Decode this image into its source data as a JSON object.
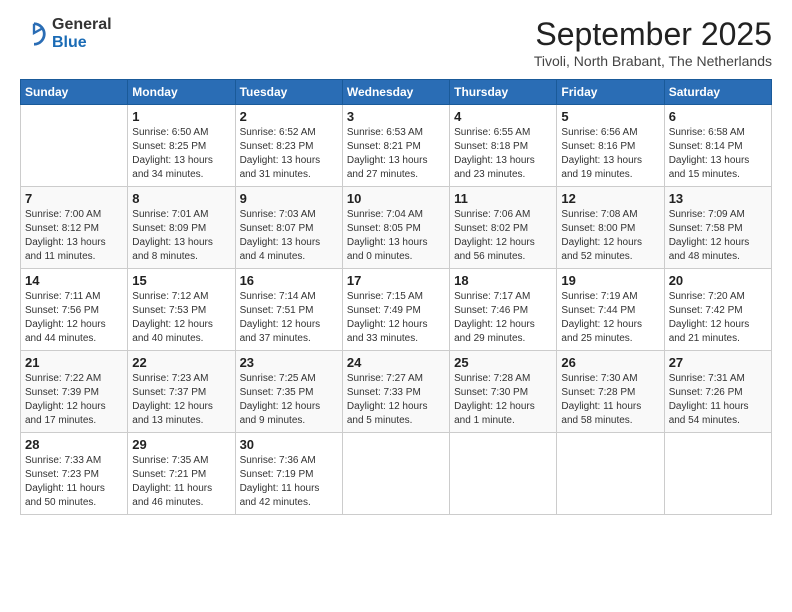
{
  "header": {
    "logo": {
      "general": "General",
      "blue": "Blue"
    },
    "month": "September 2025",
    "location": "Tivoli, North Brabant, The Netherlands"
  },
  "weekdays": [
    "Sunday",
    "Monday",
    "Tuesday",
    "Wednesday",
    "Thursday",
    "Friday",
    "Saturday"
  ],
  "weeks": [
    [
      {
        "day": "",
        "sunrise": "",
        "sunset": "",
        "daylight": ""
      },
      {
        "day": "1",
        "sunrise": "Sunrise: 6:50 AM",
        "sunset": "Sunset: 8:25 PM",
        "daylight": "Daylight: 13 hours and 34 minutes."
      },
      {
        "day": "2",
        "sunrise": "Sunrise: 6:52 AM",
        "sunset": "Sunset: 8:23 PM",
        "daylight": "Daylight: 13 hours and 31 minutes."
      },
      {
        "day": "3",
        "sunrise": "Sunrise: 6:53 AM",
        "sunset": "Sunset: 8:21 PM",
        "daylight": "Daylight: 13 hours and 27 minutes."
      },
      {
        "day": "4",
        "sunrise": "Sunrise: 6:55 AM",
        "sunset": "Sunset: 8:18 PM",
        "daylight": "Daylight: 13 hours and 23 minutes."
      },
      {
        "day": "5",
        "sunrise": "Sunrise: 6:56 AM",
        "sunset": "Sunset: 8:16 PM",
        "daylight": "Daylight: 13 hours and 19 minutes."
      },
      {
        "day": "6",
        "sunrise": "Sunrise: 6:58 AM",
        "sunset": "Sunset: 8:14 PM",
        "daylight": "Daylight: 13 hours and 15 minutes."
      }
    ],
    [
      {
        "day": "7",
        "sunrise": "Sunrise: 7:00 AM",
        "sunset": "Sunset: 8:12 PM",
        "daylight": "Daylight: 13 hours and 11 minutes."
      },
      {
        "day": "8",
        "sunrise": "Sunrise: 7:01 AM",
        "sunset": "Sunset: 8:09 PM",
        "daylight": "Daylight: 13 hours and 8 minutes."
      },
      {
        "day": "9",
        "sunrise": "Sunrise: 7:03 AM",
        "sunset": "Sunset: 8:07 PM",
        "daylight": "Daylight: 13 hours and 4 minutes."
      },
      {
        "day": "10",
        "sunrise": "Sunrise: 7:04 AM",
        "sunset": "Sunset: 8:05 PM",
        "daylight": "Daylight: 13 hours and 0 minutes."
      },
      {
        "day": "11",
        "sunrise": "Sunrise: 7:06 AM",
        "sunset": "Sunset: 8:02 PM",
        "daylight": "Daylight: 12 hours and 56 minutes."
      },
      {
        "day": "12",
        "sunrise": "Sunrise: 7:08 AM",
        "sunset": "Sunset: 8:00 PM",
        "daylight": "Daylight: 12 hours and 52 minutes."
      },
      {
        "day": "13",
        "sunrise": "Sunrise: 7:09 AM",
        "sunset": "Sunset: 7:58 PM",
        "daylight": "Daylight: 12 hours and 48 minutes."
      }
    ],
    [
      {
        "day": "14",
        "sunrise": "Sunrise: 7:11 AM",
        "sunset": "Sunset: 7:56 PM",
        "daylight": "Daylight: 12 hours and 44 minutes."
      },
      {
        "day": "15",
        "sunrise": "Sunrise: 7:12 AM",
        "sunset": "Sunset: 7:53 PM",
        "daylight": "Daylight: 12 hours and 40 minutes."
      },
      {
        "day": "16",
        "sunrise": "Sunrise: 7:14 AM",
        "sunset": "Sunset: 7:51 PM",
        "daylight": "Daylight: 12 hours and 37 minutes."
      },
      {
        "day": "17",
        "sunrise": "Sunrise: 7:15 AM",
        "sunset": "Sunset: 7:49 PM",
        "daylight": "Daylight: 12 hours and 33 minutes."
      },
      {
        "day": "18",
        "sunrise": "Sunrise: 7:17 AM",
        "sunset": "Sunset: 7:46 PM",
        "daylight": "Daylight: 12 hours and 29 minutes."
      },
      {
        "day": "19",
        "sunrise": "Sunrise: 7:19 AM",
        "sunset": "Sunset: 7:44 PM",
        "daylight": "Daylight: 12 hours and 25 minutes."
      },
      {
        "day": "20",
        "sunrise": "Sunrise: 7:20 AM",
        "sunset": "Sunset: 7:42 PM",
        "daylight": "Daylight: 12 hours and 21 minutes."
      }
    ],
    [
      {
        "day": "21",
        "sunrise": "Sunrise: 7:22 AM",
        "sunset": "Sunset: 7:39 PM",
        "daylight": "Daylight: 12 hours and 17 minutes."
      },
      {
        "day": "22",
        "sunrise": "Sunrise: 7:23 AM",
        "sunset": "Sunset: 7:37 PM",
        "daylight": "Daylight: 12 hours and 13 minutes."
      },
      {
        "day": "23",
        "sunrise": "Sunrise: 7:25 AM",
        "sunset": "Sunset: 7:35 PM",
        "daylight": "Daylight: 12 hours and 9 minutes."
      },
      {
        "day": "24",
        "sunrise": "Sunrise: 7:27 AM",
        "sunset": "Sunset: 7:33 PM",
        "daylight": "Daylight: 12 hours and 5 minutes."
      },
      {
        "day": "25",
        "sunrise": "Sunrise: 7:28 AM",
        "sunset": "Sunset: 7:30 PM",
        "daylight": "Daylight: 12 hours and 1 minute."
      },
      {
        "day": "26",
        "sunrise": "Sunrise: 7:30 AM",
        "sunset": "Sunset: 7:28 PM",
        "daylight": "Daylight: 11 hours and 58 minutes."
      },
      {
        "day": "27",
        "sunrise": "Sunrise: 7:31 AM",
        "sunset": "Sunset: 7:26 PM",
        "daylight": "Daylight: 11 hours and 54 minutes."
      }
    ],
    [
      {
        "day": "28",
        "sunrise": "Sunrise: 7:33 AM",
        "sunset": "Sunset: 7:23 PM",
        "daylight": "Daylight: 11 hours and 50 minutes."
      },
      {
        "day": "29",
        "sunrise": "Sunrise: 7:35 AM",
        "sunset": "Sunset: 7:21 PM",
        "daylight": "Daylight: 11 hours and 46 minutes."
      },
      {
        "day": "30",
        "sunrise": "Sunrise: 7:36 AM",
        "sunset": "Sunset: 7:19 PM",
        "daylight": "Daylight: 11 hours and 42 minutes."
      },
      {
        "day": "",
        "sunrise": "",
        "sunset": "",
        "daylight": ""
      },
      {
        "day": "",
        "sunrise": "",
        "sunset": "",
        "daylight": ""
      },
      {
        "day": "",
        "sunrise": "",
        "sunset": "",
        "daylight": ""
      },
      {
        "day": "",
        "sunrise": "",
        "sunset": "",
        "daylight": ""
      }
    ]
  ]
}
